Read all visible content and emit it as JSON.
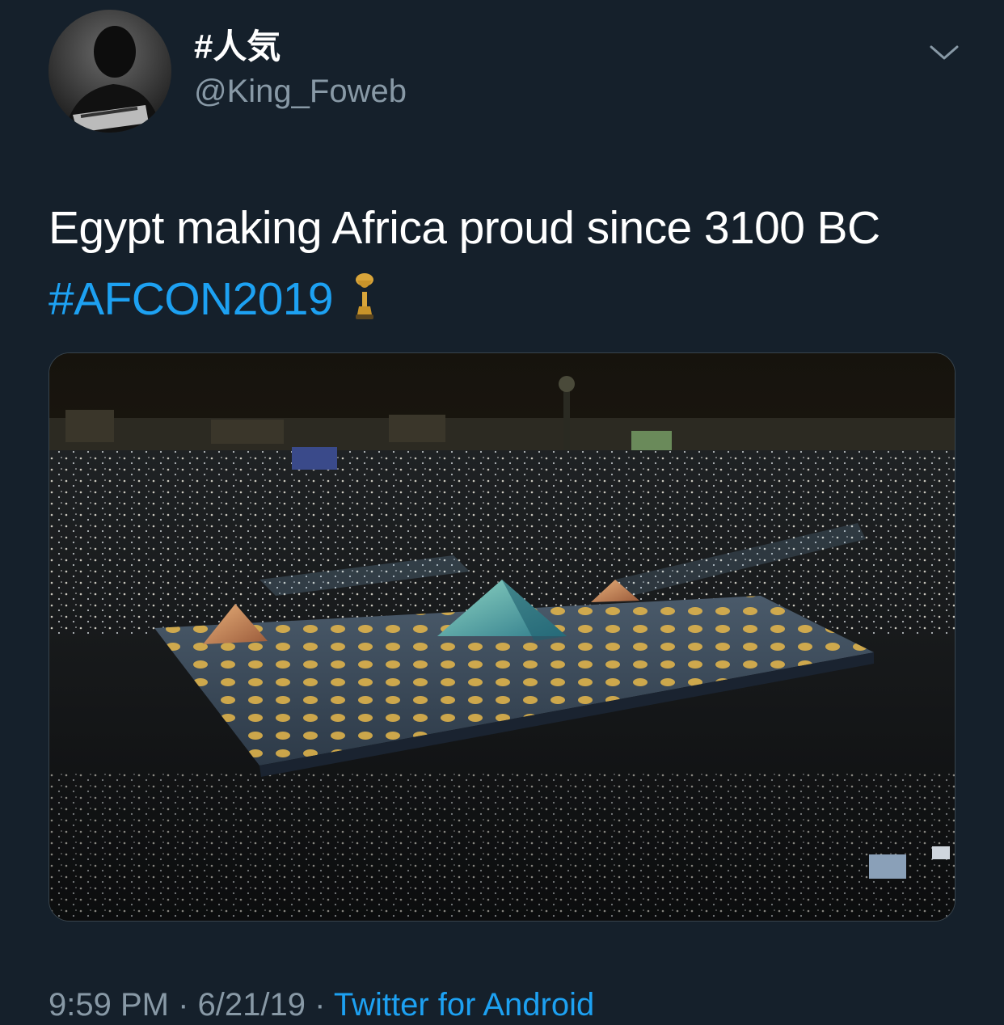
{
  "user": {
    "display_name": "#人気",
    "handle": "@King_Foweb",
    "avatar_icon": "profile-photo"
  },
  "tweet": {
    "text": "Egypt making Africa proud since 3100 BC",
    "hashtag": "#AFCON2019",
    "emoji_icon": "trophy-icon"
  },
  "menu_icon": "chevron-down-icon",
  "meta": {
    "time": "9:59 PM",
    "date": "6/21/19",
    "separator": "·",
    "source": "Twitter for Android"
  },
  "colors": {
    "background": "#15202b",
    "accent": "#1da1f2",
    "secondary_text": "#8899a6",
    "border": "#38444d"
  }
}
